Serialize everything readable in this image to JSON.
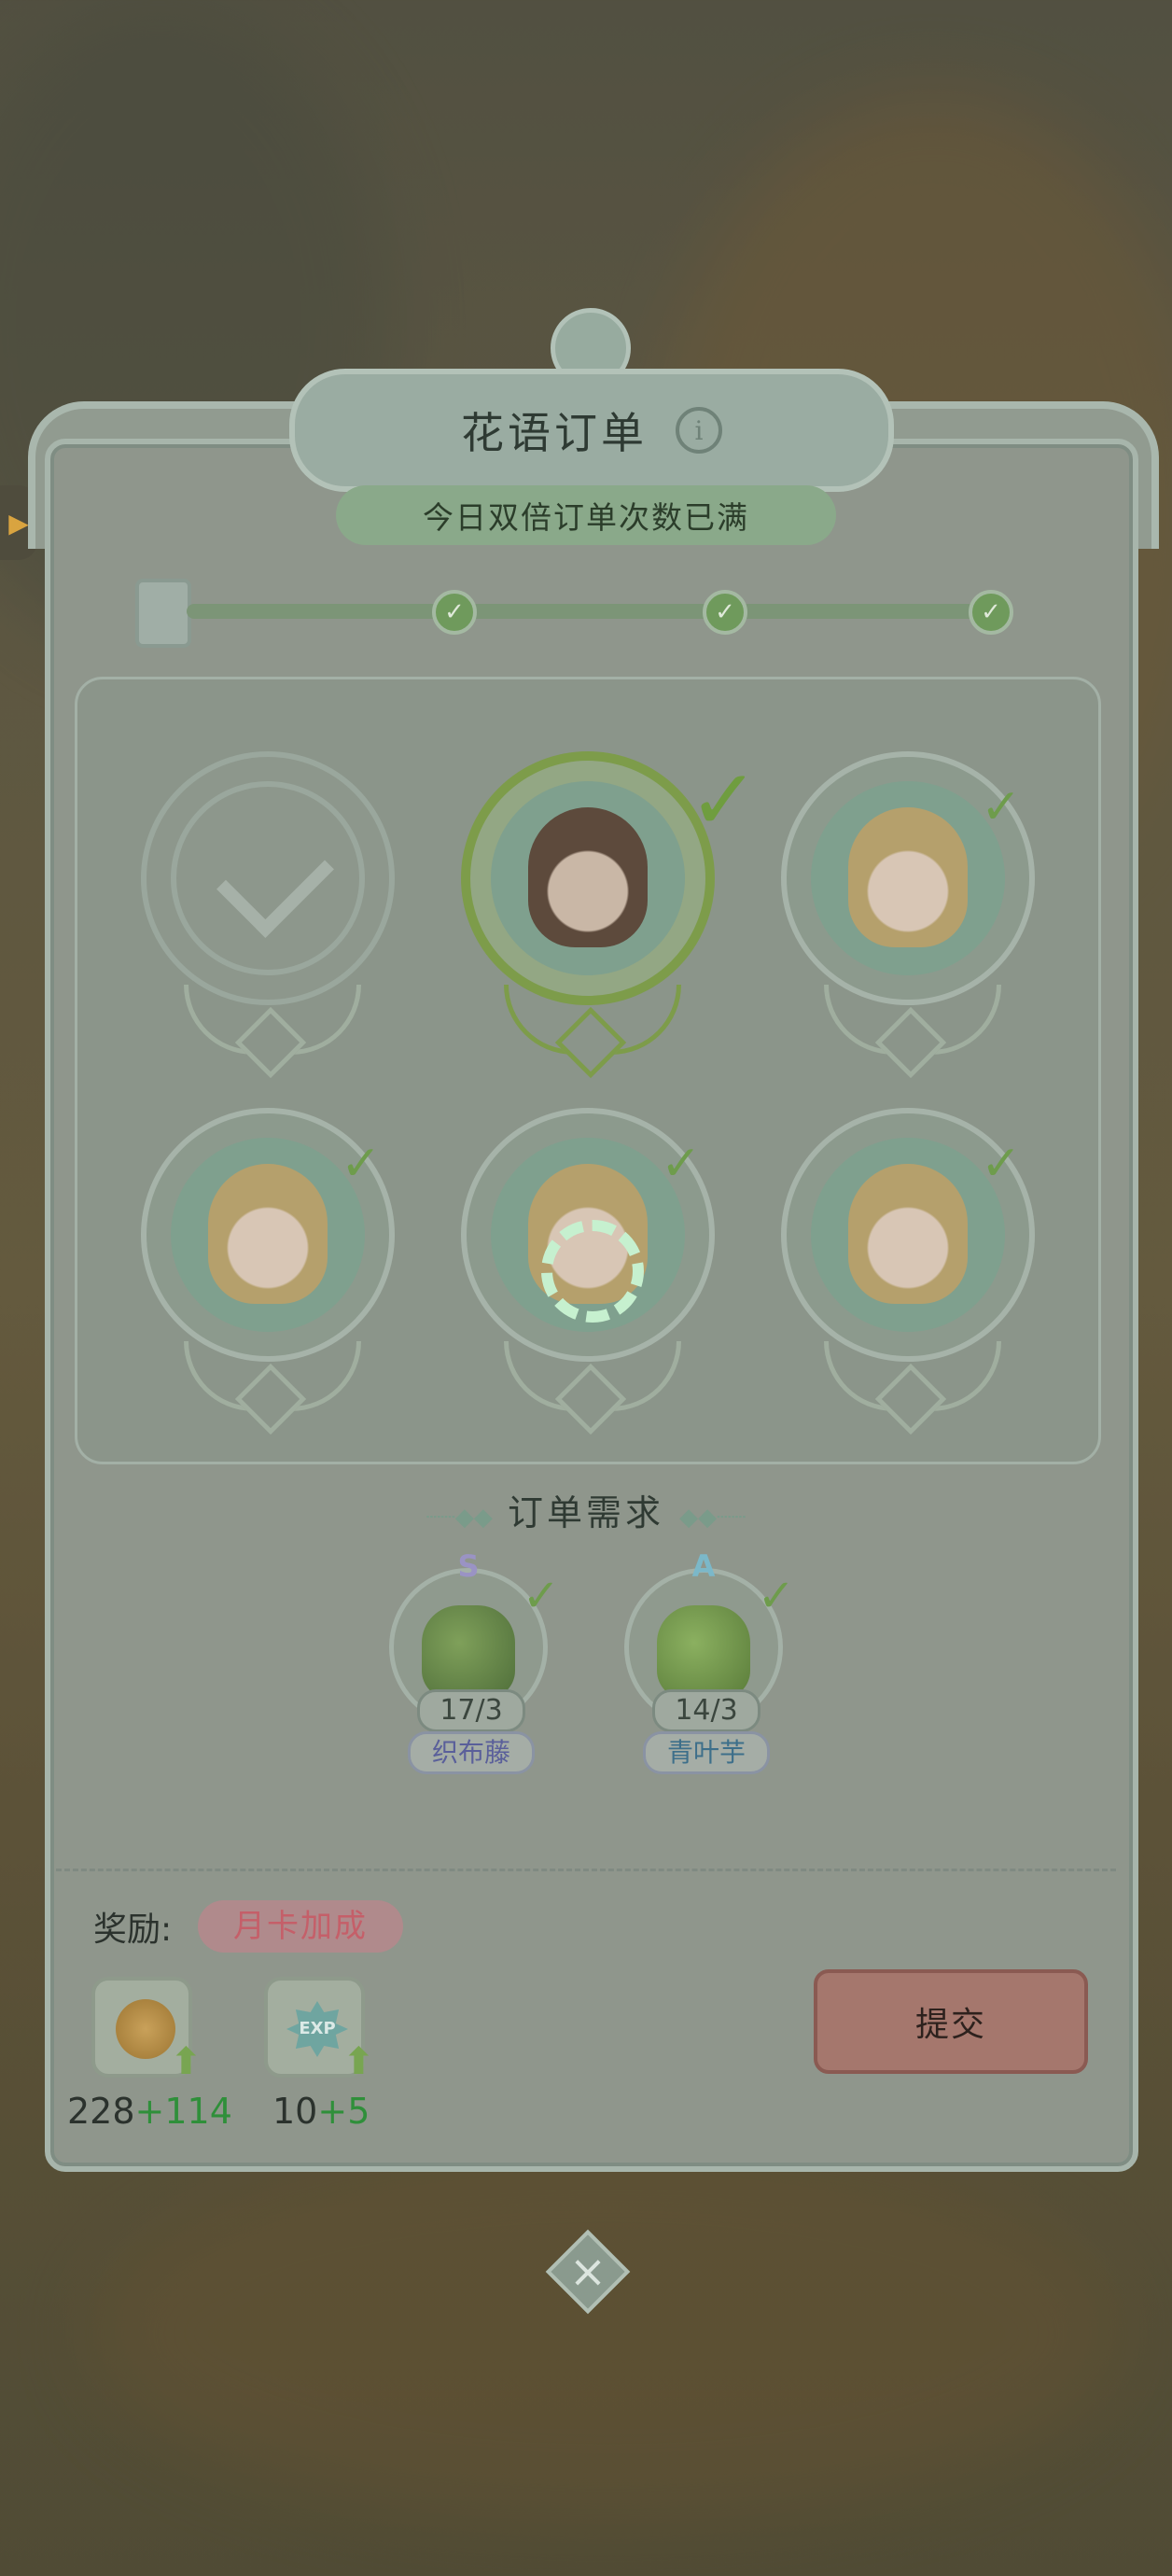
{
  "title": "花语订单",
  "banner": "今日双倍订单次数已满",
  "demand_title": "订单需求",
  "items": [
    {
      "grade": "S",
      "count": "17/3",
      "name": "织布藤",
      "grade_color": "#9a93c4",
      "name_color": "#5a5f9a"
    },
    {
      "grade": "A",
      "count": "14/3",
      "name": "青叶芋",
      "grade_color": "#7bb8c9",
      "name_color": "#3d6f8a"
    }
  ],
  "reward": {
    "label": "奖励:",
    "month_card": "月卡加成",
    "coin": {
      "base": "228",
      "bonus": "+114"
    },
    "exp": {
      "icon_text": "EXP",
      "base": "10",
      "bonus": "+5"
    }
  },
  "submit": "提交",
  "icons": {
    "info": "i",
    "close": "×",
    "check": "✓"
  },
  "colors": {
    "accent_green": "#6f9d3f",
    "submit": "#a5776d",
    "bonus_green": "#2f8f3a"
  }
}
